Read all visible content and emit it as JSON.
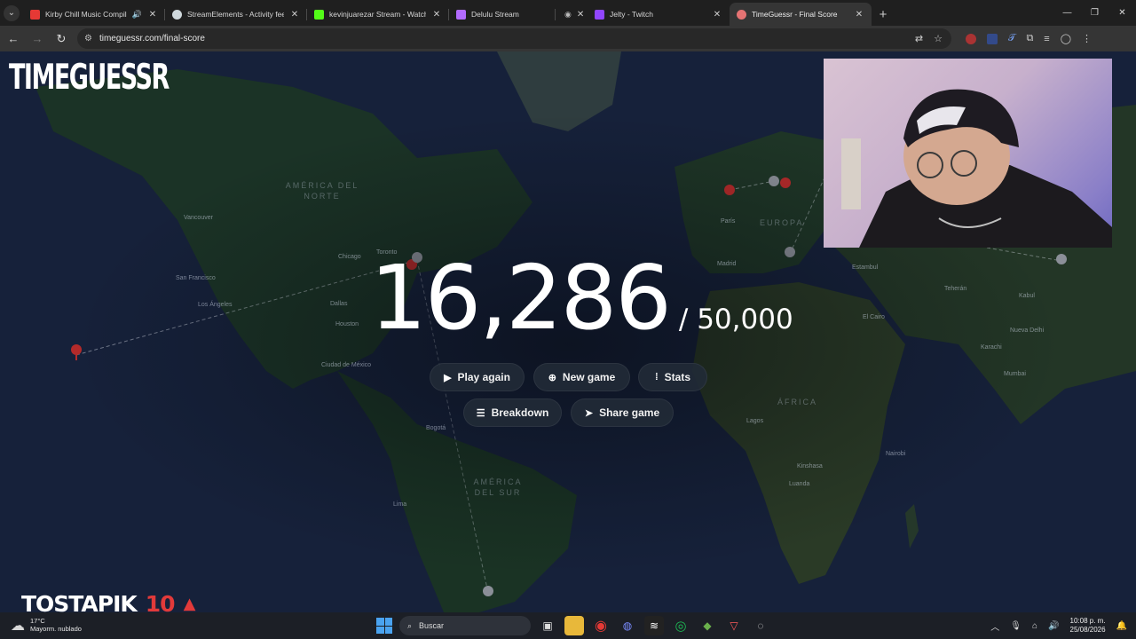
{
  "browser": {
    "tabs": [
      {
        "title": "Kirby Chill Music Compilatio",
        "favicon_color": "#e53935",
        "audio": true
      },
      {
        "title": "StreamElements - Activity feed",
        "favicon_color": "#cfd8dc"
      },
      {
        "title": "kevinjuarezar Stream - Watch L",
        "favicon_color": "#53fc18"
      },
      {
        "title": "Delulu Stream",
        "favicon_color": "#b36bff"
      },
      {
        "title": "",
        "favicon_color": "#9e9e9e",
        "record": true
      },
      {
        "title": "Jelty - Twitch",
        "favicon_color": "#9146ff"
      },
      {
        "title": "TimeGuessr - Final Score",
        "favicon_color": "#e57373",
        "active": true
      }
    ],
    "url": "timeguessr.com/final-score"
  },
  "game": {
    "logo": "TIMEGUESSR",
    "score": "16,286",
    "max_score": "/ 50,000",
    "buttons_row1": [
      {
        "label": "Play again",
        "icon": "play-icon"
      },
      {
        "label": "New game",
        "icon": "plus-circle-icon"
      },
      {
        "label": "Stats",
        "icon": "stats-icon"
      }
    ],
    "buttons_row2": [
      {
        "label": "Breakdown",
        "icon": "list-icon"
      },
      {
        "label": "Share game",
        "icon": "send-icon"
      }
    ]
  },
  "map": {
    "regions": [
      "AMÉRICA DEL NORTE",
      "EUROPA",
      "ÁFRICA",
      "AMÉRICA DEL SUR"
    ],
    "cities": [
      "Vancouver",
      "San Francisco",
      "Los Ángeles",
      "Chicago",
      "Toronto",
      "Dallas",
      "Houston",
      "Ciudad de México",
      "Madrid",
      "París",
      "Estambul",
      "Teherán",
      "Kabul",
      "Karachi",
      "Mumbai",
      "Nueva Delhi",
      "Lagos",
      "Kinshasa",
      "Luanda",
      "Nairobi",
      "El Cairo",
      "Bogotá",
      "Lima"
    ]
  },
  "stream_overlay": {
    "name": "TOSTAPIK",
    "number": "10"
  },
  "taskbar": {
    "temperature": "17°C",
    "weather": "Mayorm. nublado",
    "search_placeholder": "Buscar",
    "time": "10:08 p. m.",
    "date": "25/08/2026"
  }
}
